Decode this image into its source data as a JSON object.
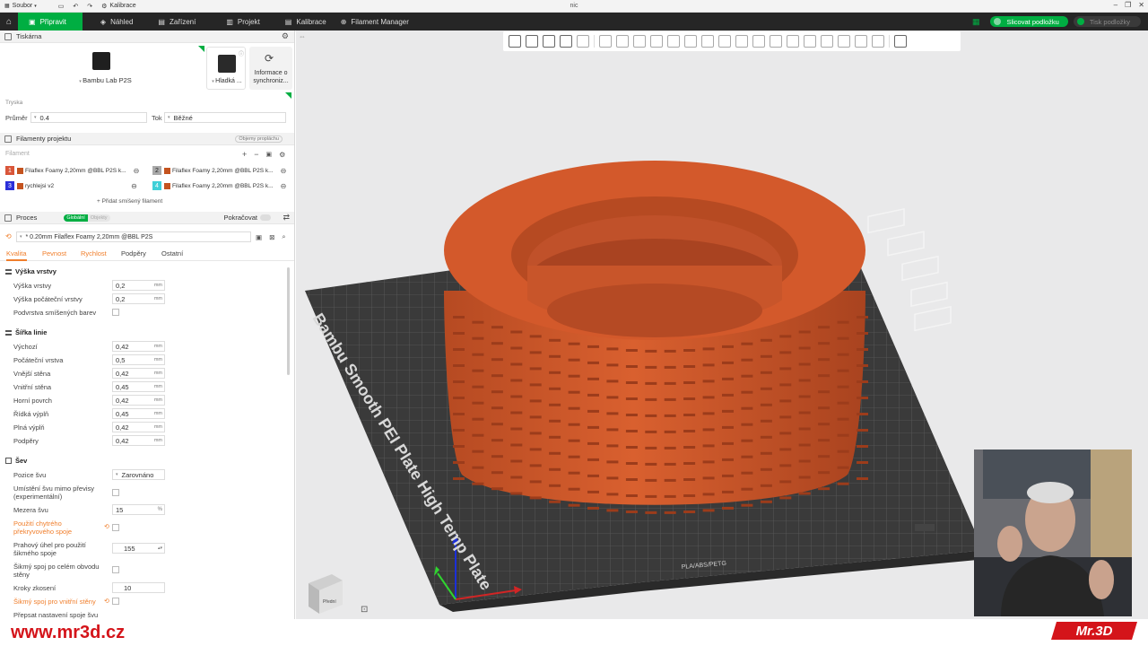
{
  "titlebar": {
    "menu": "Soubor",
    "calibration": "Kalibrace",
    "title": "nic"
  },
  "menubar": {
    "tabs": [
      "Připravit",
      "Náhled",
      "Zařízení",
      "Projekt",
      "Kalibrace",
      "Filament Manager"
    ],
    "slice_btn": "Slicovat podložku",
    "print_btn": "Tisk podložky"
  },
  "printer": {
    "section": "Tiskárna",
    "name": "Bambu Lab P2S",
    "plate": "Hladká ...",
    "sync_line1": "Informace o",
    "sync_line2": "synchroniz...",
    "nozzle_label": "Tryska",
    "diameter_label": "Průměr",
    "diameter": "0.4",
    "flow_label": "Tok",
    "flow": "Běžné"
  },
  "filaments": {
    "section": "Filamenty projektu",
    "badge": "Objemy propláchu",
    "placeholder": "Filament",
    "items": [
      {
        "num": "1",
        "num_color": "#d9563a",
        "swatch": "#c4531f",
        "name": "Filaflex  Foamy 2,20mm @BBL P2S k..."
      },
      {
        "num": "2",
        "num_color": "#a9a9a9",
        "swatch": "#c4531f",
        "name": "Filaflex  Foamy 2,20mm @BBL P2S k..."
      },
      {
        "num": "3",
        "num_color": "#2b2fd9",
        "swatch": "#c4531f",
        "name": "rychlejsi v2"
      },
      {
        "num": "4",
        "num_color": "#3fd0d8",
        "swatch": "#c4531f",
        "name": "Filaflex  Foamy 2,20mm @BBL P2S k..."
      }
    ],
    "add": "+ Přidat smíšený filament"
  },
  "process": {
    "section": "Proces",
    "toggle_global": "Globální",
    "toggle_objects": "Objekty",
    "advanced": "Pokračovat",
    "profile": "* 0.20mm Filaflex  Foamy 2,20mm @BBL P2S",
    "tabs": [
      "Kvalita",
      "Pevnost",
      "Rychlost",
      "Podpěry",
      "Ostatní"
    ]
  },
  "layer_height": {
    "title": "Výška vrstvy",
    "rows": [
      {
        "label": "Výška vrstvy",
        "value": "0,2",
        "unit": "mm"
      },
      {
        "label": "Výška počáteční vrstvy",
        "value": "0,2",
        "unit": "mm"
      }
    ],
    "sublayer_label": "Podvrstva smíšených barev"
  },
  "line_width": {
    "title": "Šířka linie",
    "rows": [
      {
        "label": "Výchozí",
        "value": "0,42",
        "unit": "mm"
      },
      {
        "label": "Počáteční vrstva",
        "value": "0,5",
        "unit": "mm"
      },
      {
        "label": "Vnější stěna",
        "value": "0,42",
        "unit": "mm"
      },
      {
        "label": "Vnitřní stěna",
        "value": "0,45",
        "unit": "mm"
      },
      {
        "label": "Horní povrch",
        "value": "0,42",
        "unit": "mm"
      },
      {
        "label": "Řídká výplň",
        "value": "0,45",
        "unit": "mm"
      },
      {
        "label": "Plná výplň",
        "value": "0,42",
        "unit": "mm"
      },
      {
        "label": "Podpěry",
        "value": "0,42",
        "unit": "mm"
      }
    ]
  },
  "seam": {
    "title": "Šev",
    "position_label": "Pozice švu",
    "position_value": "Zarovnáno",
    "offwall_label1": "Umístění švu mimo převisy",
    "offwall_label2": "(experimentální)",
    "gap_label": "Mezera švu",
    "gap_value": "15",
    "gap_unit": "%",
    "smart_label1": "Použití chytrého",
    "smart_label2": "překryvového spoje",
    "threshold_label1": "Prahový úhel pro použití",
    "threshold_label2": "šikmého spoje",
    "threshold_value": "155",
    "scarf_full_label1": "Šikmý spoj po celém obvodu",
    "scarf_full_label2": "stěny",
    "steps_label": "Kroky zkosení",
    "steps_value": "10",
    "inner_label": "Šikmý spoj pro vnitřní stěny",
    "override_label": "Přepsat nastavení spoje švu"
  },
  "viewport": {
    "plate_text": "Bambu Smooth PEI Plate High Temp Plate",
    "plate_front": "PLA/ABS/PETG",
    "cube_label": "Přední"
  },
  "footer": {
    "site": "www.mr3d.cz",
    "brand": "Mr.3D"
  },
  "colors": {
    "accent": "#00ae42",
    "model": "#c9502a",
    "menubar": "#262626",
    "site_red": "#d4141a"
  }
}
